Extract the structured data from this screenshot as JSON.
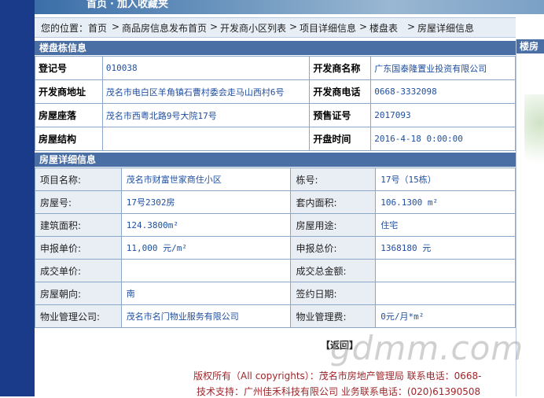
{
  "top_nav": {
    "home": "首页",
    "favorite": "加入收藏夹"
  },
  "breadcrumb": {
    "prefix": "您的位置：",
    "items": [
      "首页",
      "商品房信息发布首页",
      "开发商小区列表",
      "项目详细信息",
      "楼盘表",
      "房屋详细信息"
    ],
    "separator": ">"
  },
  "building": {
    "header": "楼盘栋信息",
    "reg_label": "登记号",
    "reg_value": "010038",
    "dev_label": "开发商名称",
    "dev_value": "广东国泰隆置业投资有限公司",
    "addr_label": "开发商地址",
    "addr_value": "茂名市电白区羊角镇石曹村委会走马山西村6号",
    "phone_label": "开发商电话",
    "phone_value": "0668-3332098",
    "loc_label": "房屋座落",
    "loc_value": "茂名市西粤北路9号大院17号",
    "presale_label": "预售证号",
    "presale_value": "2017093",
    "struct_label": "房屋结构",
    "struct_value": "",
    "open_label": "开盘时间",
    "open_value": "2016-4-18 0:00:00"
  },
  "house": {
    "header": "房屋详细信息",
    "rows": [
      [
        "项目名称:",
        "茂名市财富世家商住小区",
        "栋号:",
        "17号（15栋）"
      ],
      [
        "房屋号:",
        "17号2302房",
        "套内面积:",
        "106.1300 m²"
      ],
      [
        "建筑面积:",
        "124.3800m²",
        "房屋用途:",
        "住宅"
      ],
      [
        "申报单价:",
        "11,000 元/m²",
        "申报总价:",
        "1368180 元"
      ],
      [
        "成交单价:",
        "",
        "成交总金额:",
        ""
      ],
      [
        "房屋朝向:",
        "南",
        "签约日期:",
        ""
      ],
      [
        "物业管理公司:",
        "茂名市名门物业服务有限公司",
        "物业管理费:",
        "0元/月*m²"
      ]
    ]
  },
  "right_panel": {
    "header": "楼房"
  },
  "back_button": "【返回】",
  "footer": {
    "line1": "版权所有（All copyrights）：茂名市房地产管理局 联系电话：0668-",
    "line2": "技术支持：广州佳禾科技有限公司    业务联系电话：(020)61390508"
  },
  "watermark": "gdmm.com"
}
